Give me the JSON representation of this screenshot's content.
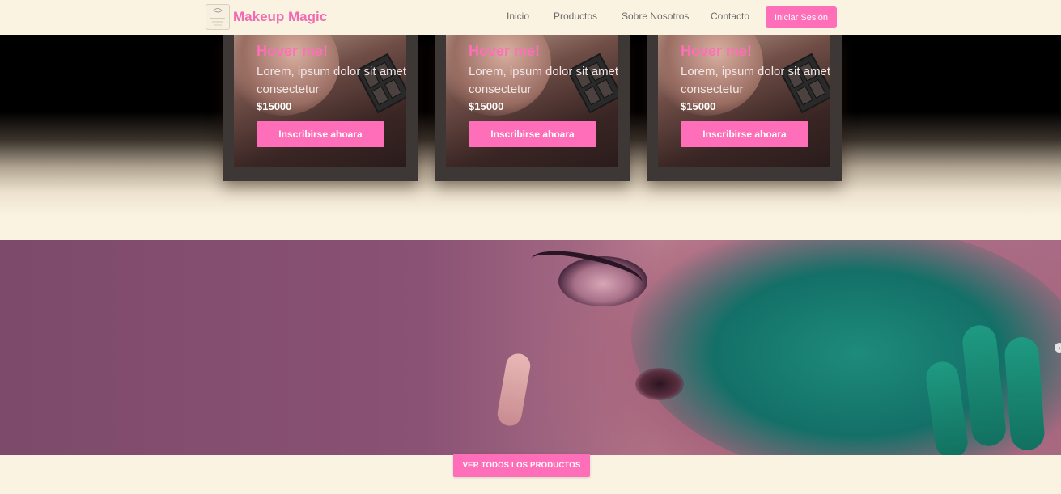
{
  "header": {
    "brand": "Makeup Magic",
    "logo_icon": "makeup-logo",
    "nav": [
      "Inicio",
      "Productos",
      "Sobre Nosotros",
      "Contacto"
    ],
    "login_label": "Iniciar Sesión"
  },
  "products": [
    {
      "title": "Hover me!",
      "description": "Lorem, ipsum dolor sit amet consectetur",
      "price": "$15000",
      "button": "Inscribirse ahoara"
    },
    {
      "title": "Hover me!",
      "description": "Lorem, ipsum dolor sit amet consectetur",
      "price": "$15000",
      "button": "Inscribirse ahoara"
    },
    {
      "title": "Hover me!",
      "description": "Lorem, ipsum dolor sit amet consectetur",
      "price": "$15000",
      "button": "Inscribirse ahoara"
    }
  ],
  "hero": {
    "slider_arrow": "›"
  },
  "cta": {
    "all_products_label": "VER TODOS LOS PRODUCTOS"
  },
  "colors": {
    "accent": "#ff6eb8",
    "brand": "#f06bb2",
    "background": "#fbf3e2"
  }
}
